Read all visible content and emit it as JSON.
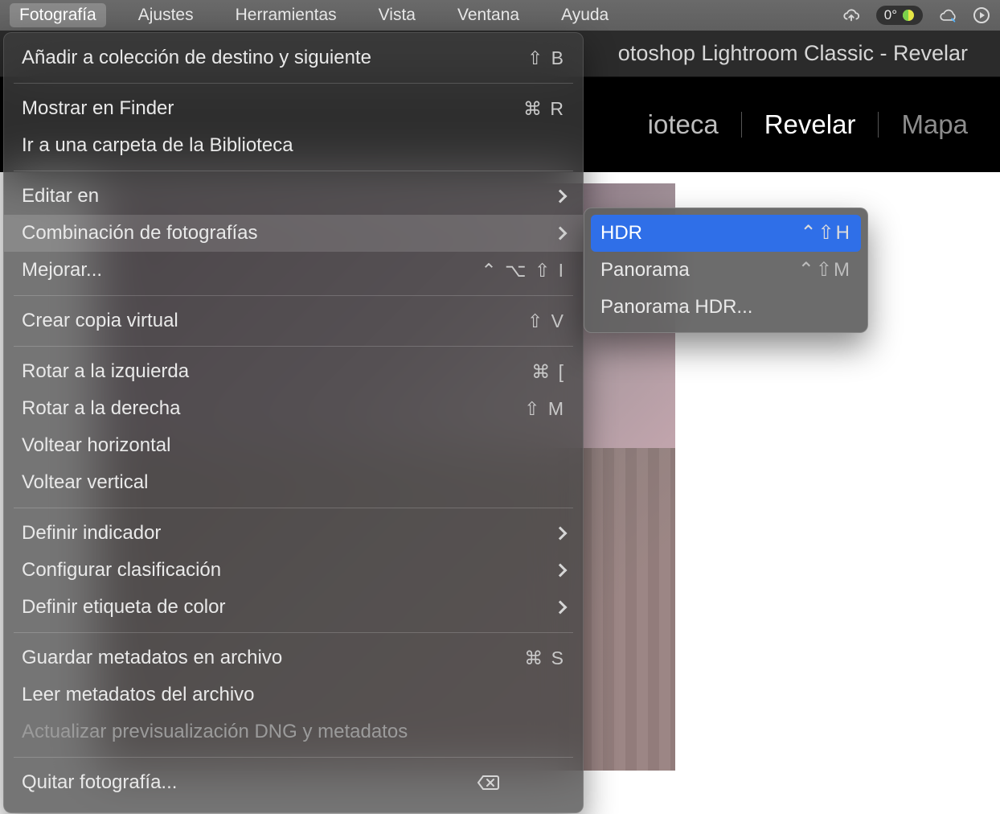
{
  "menubar": {
    "items": [
      "Fotografía",
      "Ajustes",
      "Herramientas",
      "Vista",
      "Ventana",
      "Ayuda"
    ],
    "activeIndex": 0,
    "tempPill": "0°"
  },
  "titlebar": {
    "title": "otoshop Lightroom Classic - Revelar"
  },
  "modules": {
    "partial": "ioteca",
    "tabs": [
      "Revelar",
      "Mapa"
    ],
    "activeIndex": 0
  },
  "menu": {
    "rows": [
      {
        "label": "Añadir a colección de destino y siguiente",
        "shortcut": "⇧ B"
      },
      {
        "sep": true
      },
      {
        "label": "Mostrar en Finder",
        "shortcut": "⌘ R"
      },
      {
        "label": "Ir a una carpeta de la Biblioteca"
      },
      {
        "sep": true
      },
      {
        "label": "Editar en",
        "submenu": true
      },
      {
        "label": "Combinación de fotografías",
        "submenu": true,
        "hover": true
      },
      {
        "label": "Mejorar...",
        "shortcut": "⌃ ⌥ ⇧  I"
      },
      {
        "sep": true
      },
      {
        "label": "Crear copia virtual",
        "shortcut": "⇧ V"
      },
      {
        "sep": true
      },
      {
        "label": "Rotar a la izquierda",
        "shortcut": "⌘ ["
      },
      {
        "label": "Rotar a la derecha",
        "shortcut": "⇧ M"
      },
      {
        "label": "Voltear horizontal"
      },
      {
        "label": "Voltear vertical"
      },
      {
        "sep": true
      },
      {
        "label": "Definir indicador",
        "submenu": true
      },
      {
        "label": "Configurar clasificación",
        "submenu": true
      },
      {
        "label": "Definir etiqueta de color",
        "submenu": true
      },
      {
        "sep": true
      },
      {
        "label": "Guardar metadatos en archivo",
        "shortcut": "⌘ S"
      },
      {
        "label": "Leer metadatos del archivo"
      },
      {
        "label": "Actualizar previsualización DNG y metadatos",
        "disabled": true
      },
      {
        "sep": true
      },
      {
        "label": "Quitar fotografía...",
        "eraseIcon": true
      }
    ]
  },
  "submenu": {
    "rows": [
      {
        "label": "HDR",
        "shortcut": "⌃⇧H",
        "selected": true
      },
      {
        "label": "Panorama",
        "shortcut": "⌃⇧M"
      },
      {
        "label": "Panorama HDR..."
      }
    ]
  }
}
